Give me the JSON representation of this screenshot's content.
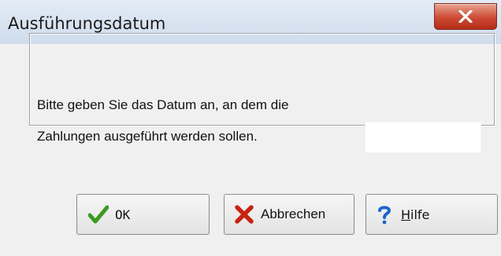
{
  "dialog": {
    "title": "Ausführungsdatum",
    "message_line1": "Bitte geben Sie das Datum an, an dem die",
    "message_line2": "Zahlungen ausgeführt werden sollen.",
    "date_value": ""
  },
  "buttons": {
    "ok": "OK",
    "cancel": "Abbrechen",
    "help_first": "H",
    "help_rest": "ilfe"
  },
  "icons": {
    "close": "close-icon",
    "ok": "checkmark-icon",
    "cancel": "cross-icon",
    "help": "question-mark-icon"
  },
  "colors": {
    "close_button": "#cd4a33",
    "ok_icon": "#3c9a1f",
    "cancel_icon": "#c8230f",
    "help_icon": "#1b66c9"
  }
}
